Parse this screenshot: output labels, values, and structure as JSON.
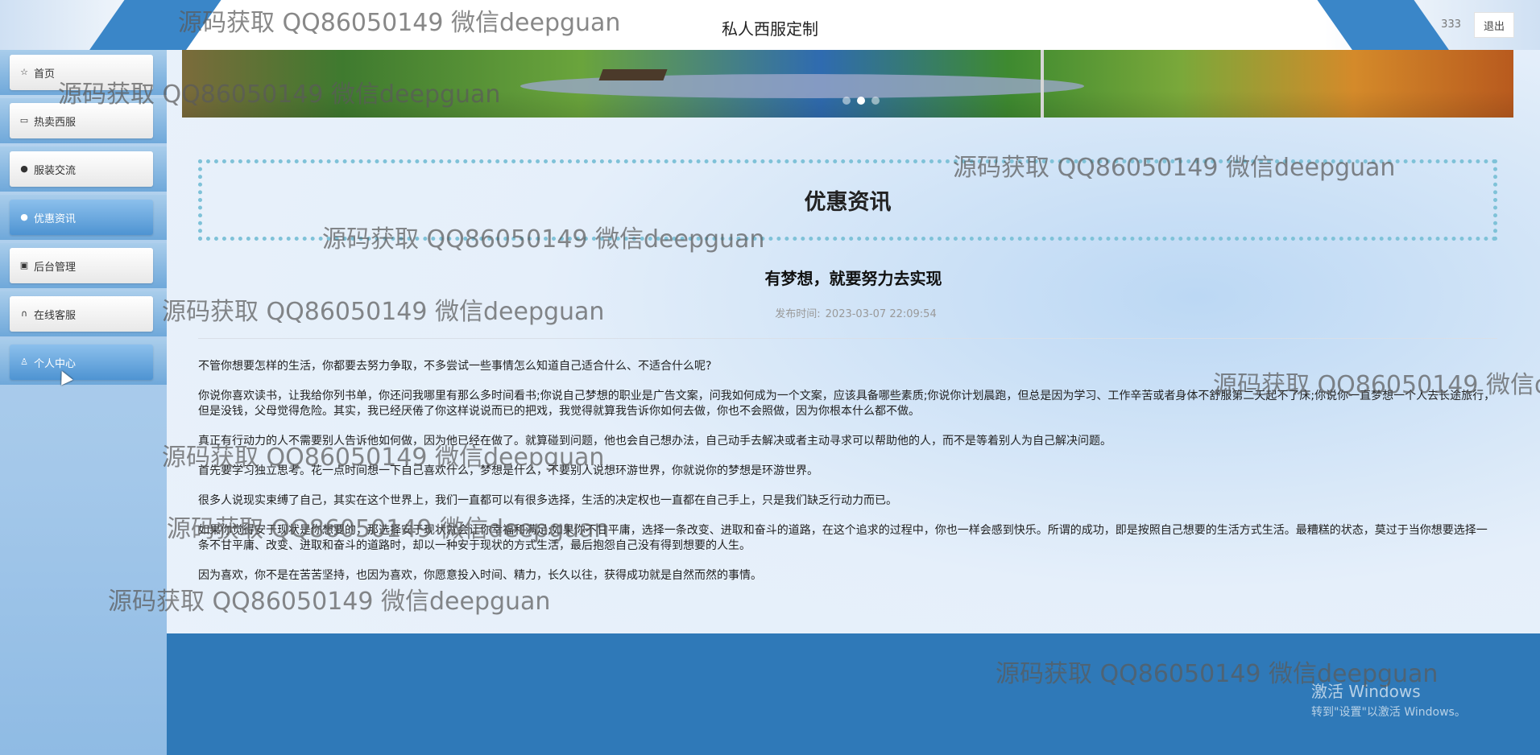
{
  "header": {
    "site_title": "私人西服定制",
    "user_name": "333",
    "logout_label": "退出"
  },
  "sidebar": {
    "items": [
      {
        "label": "首页",
        "icon": "star-icon",
        "active": false
      },
      {
        "label": "热卖西服",
        "icon": "bag-icon",
        "active": false
      },
      {
        "label": "服装交流",
        "icon": "info-circle-icon",
        "active": false
      },
      {
        "label": "优惠资讯",
        "icon": "circle-icon",
        "active": true
      },
      {
        "label": "后台管理",
        "icon": "briefcase-icon",
        "active": false
      },
      {
        "label": "在线客服",
        "icon": "headset-icon",
        "active": false
      },
      {
        "label": "个人中心",
        "icon": "user-icon",
        "active": false
      }
    ]
  },
  "banner": {
    "slides": 3,
    "active_slide": 2
  },
  "page": {
    "section_title": "优惠资讯",
    "article_title": "有梦想，就要努力去实现",
    "publish_label": "发布时间:",
    "publish_time": "2023-03-07 22:09:54"
  },
  "article": {
    "paragraphs": [
      "不管你想要怎样的生活，你都要去努力争取，不多尝试一些事情怎么知道自己适合什么、不适合什么呢?",
      "你说你喜欢读书，让我给你列书单，你还问我哪里有那么多时间看书;你说自己梦想的职业是广告文案，问我如何成为一个文案，应该具备哪些素质;你说你计划晨跑，但总是因为学习、工作辛苦或者身体不舒服第二天起不了床;你说你一直梦想一个人去长途旅行，但是没钱，父母觉得危险。其实，我已经厌倦了你这样说说而已的把戏，我觉得就算我告诉你如何去做，你也不会照做，因为你根本什么都不做。",
      "真正有行动力的人不需要别人告诉他如何做，因为他已经在做了。就算碰到问题，他也会自己想办法，自己动手去解决或者主动寻求可以帮助他的人，而不是等着别人为自己解决问题。",
      "首先要学习独立思考。花一点时间想一下自己喜欢什么，梦想是什么，不要别人说想环游世界，你就说你的梦想是环游世界。",
      "很多人说现实束缚了自己，其实在这个世界上，我们一直都可以有很多选择，生活的决定权也一直都在自己手上，只是我们缺乏行动力而已。",
      "如果你觉得安于现状是你想要的，那选择安于现状就会让你幸福和满足;如果你不甘平庸，选择一条改变、进取和奋斗的道路，在这个追求的过程中，你也一样会感到快乐。所谓的成功，即是按照自己想要的生活方式生活。最糟糕的状态，莫过于当你想要选择一条不甘平庸、改变、进取和奋斗的道路时，却以一种安于现状的方式生活，最后抱怨自己没有得到想要的人生。",
      "因为喜欢，你不是在苦苦坚持，也因为喜欢，你愿意投入时间、精力，长久以往，获得成功就是自然而然的事情。"
    ]
  },
  "watermark": {
    "text": "源码获取 QQ86050149 微信deepguan",
    "partial_text": "源码获取 QQ86050149 微信d"
  },
  "os_overlay": {
    "line1": "激活 Windows",
    "line2": "转到\"设置\"以激活 Windows。"
  }
}
